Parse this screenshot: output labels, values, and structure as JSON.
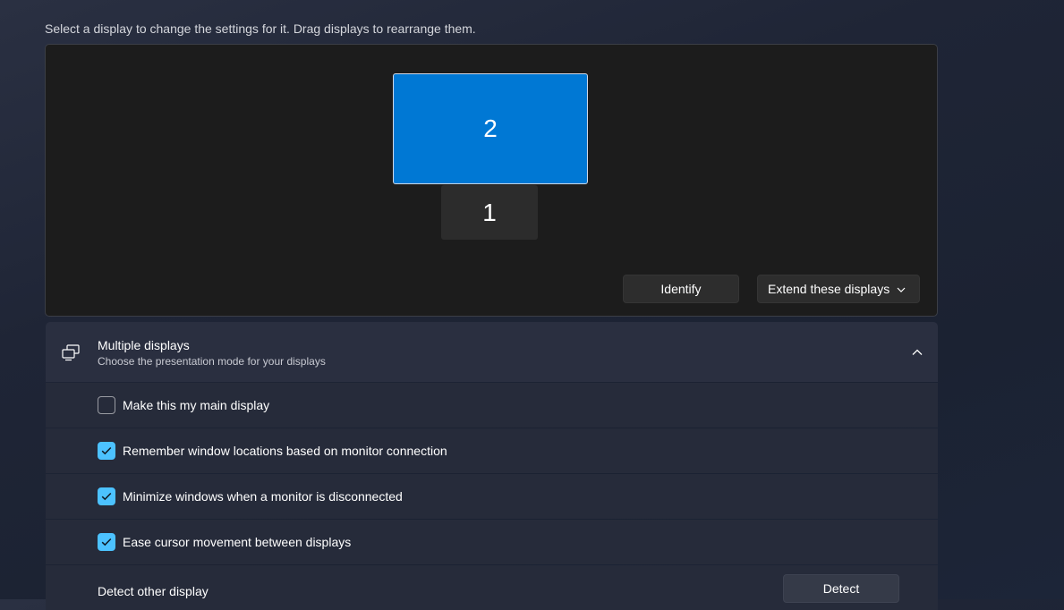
{
  "instruction": "Select a display to change the settings for it. Drag displays to rearrange them.",
  "arrangement": {
    "monitors": [
      {
        "number": "1",
        "selected": false
      },
      {
        "number": "2",
        "selected": true
      }
    ],
    "identify_label": "Identify",
    "mode_select": {
      "selected": "Extend these displays"
    }
  },
  "multiple_displays": {
    "title": "Multiple displays",
    "subtitle": "Choose the presentation mode for your displays",
    "expanded": true,
    "options": [
      {
        "label": "Make this my main display",
        "checked": false
      },
      {
        "label": "Remember window locations based on monitor connection",
        "checked": true
      },
      {
        "label": "Minimize windows when a monitor is disconnected",
        "checked": true
      },
      {
        "label": "Ease cursor movement between displays",
        "checked": true
      }
    ],
    "detect": {
      "label": "Detect other display",
      "button": "Detect"
    }
  },
  "colors": {
    "accent": "#0078d4",
    "checkbox_accent": "#4cc2ff",
    "panel_bg": "#1c1c1c"
  },
  "icons": {
    "header_icon": "multiple-displays-icon",
    "collapse": "chevron-up-icon",
    "dropdown": "chevron-down-icon",
    "check": "checkmark-icon"
  }
}
